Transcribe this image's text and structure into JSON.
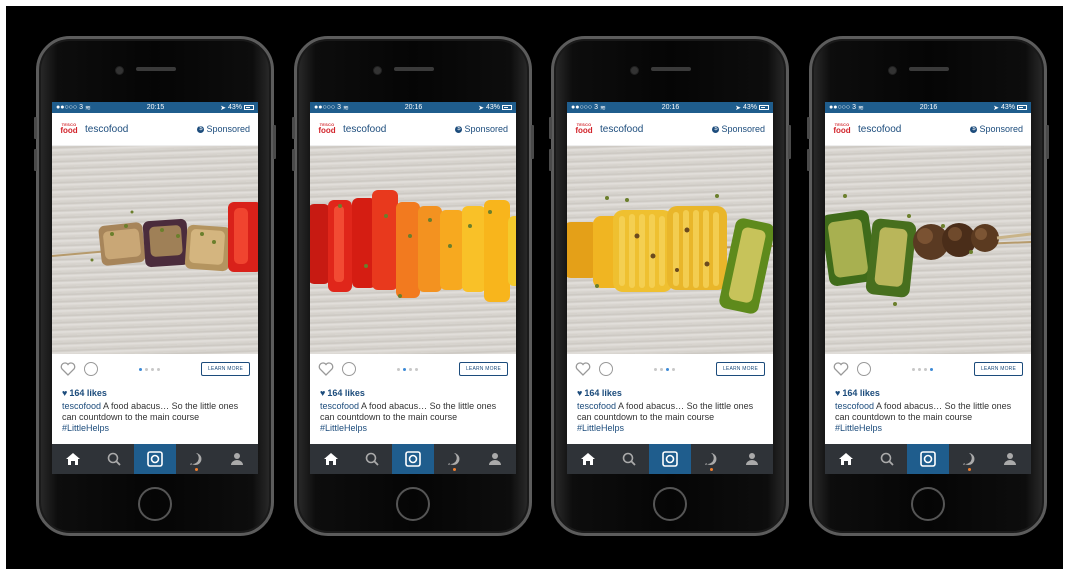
{
  "status": {
    "carrier": "●●○○○ 3",
    "battery": "43%"
  },
  "post": {
    "account": "tescofood",
    "logo_line1": "TESCO",
    "logo_line2": "food",
    "sponsored": "Sponsored",
    "learn_more": "LEARN MORE",
    "likes": "164 likes",
    "caption_user": "tescofood",
    "caption_text": " A food abacus… So the little ones can countdown to the main course",
    "hashtag": "#LittleHelps"
  },
  "phones": [
    {
      "time": "20:15",
      "active_dot": 0,
      "photo": "aubergine-pepper-skewer"
    },
    {
      "time": "20:16",
      "active_dot": 1,
      "photo": "pepper-skewer"
    },
    {
      "time": "20:16",
      "active_dot": 2,
      "photo": "corn-courgette-skewer"
    },
    {
      "time": "20:16",
      "active_dot": 3,
      "photo": "courgette-mushroom-skewer"
    }
  ],
  "tabs": [
    "home-icon",
    "search-icon",
    "camera-icon",
    "activity-icon",
    "profile-icon"
  ],
  "colors": {
    "statusbar": "#1f5d8d",
    "tabbar": "#2f3338",
    "brand_blue": "#1c4c7c",
    "tesco_red": "#d2232a"
  }
}
